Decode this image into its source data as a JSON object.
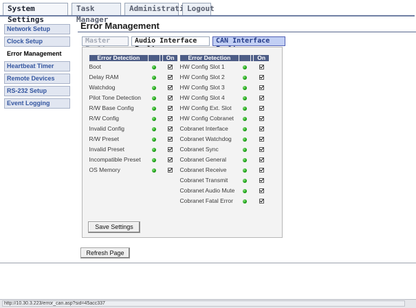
{
  "top_tabs": [
    {
      "label": "System Settings",
      "active": true
    },
    {
      "label": "Task Manager",
      "active": false
    },
    {
      "label": "Administration",
      "active": false
    },
    {
      "label": "Logout",
      "active": false
    }
  ],
  "sidebar": {
    "items": [
      {
        "label": "Network Setup",
        "active": false
      },
      {
        "label": "Clock Setup",
        "active": false
      },
      {
        "label": "Error Management",
        "active": true
      },
      {
        "label": "Heartbeat Timer",
        "active": false
      },
      {
        "label": "Remote Devices",
        "active": false
      },
      {
        "label": "RS-232 Setup",
        "active": false
      },
      {
        "label": "Event Logging",
        "active": false
      }
    ]
  },
  "page": {
    "title": "Error Management"
  },
  "sub_tabs": [
    {
      "label": "Master Fault",
      "state": "muted"
    },
    {
      "label": "Audio Interface Faults",
      "state": "plain"
    },
    {
      "label": "CAN Interface Faults",
      "state": "active"
    }
  ],
  "fault_tables": {
    "left": {
      "headers": {
        "detection": "Error Detection",
        "status": "",
        "on": "On"
      },
      "rows": [
        {
          "name": "Boot",
          "status": "ok",
          "on": true
        },
        {
          "name": "Delay RAM",
          "status": "ok",
          "on": true
        },
        {
          "name": "Watchdog",
          "status": "ok",
          "on": true
        },
        {
          "name": "Pilot Tone Detection",
          "status": "ok",
          "on": true
        },
        {
          "name": "R/W Base Config",
          "status": "ok",
          "on": true
        },
        {
          "name": "R/W Config",
          "status": "ok",
          "on": true
        },
        {
          "name": "Invalid Config",
          "status": "ok",
          "on": true
        },
        {
          "name": "R/W Preset",
          "status": "ok",
          "on": true
        },
        {
          "name": "Invalid Preset",
          "status": "ok",
          "on": true
        },
        {
          "name": "Incompatible Preset",
          "status": "ok",
          "on": true
        },
        {
          "name": "OS Memory",
          "status": "ok",
          "on": true
        }
      ]
    },
    "right": {
      "headers": {
        "detection": "Error Detection",
        "status": "",
        "on": "On"
      },
      "rows": [
        {
          "name": "HW Config Slot 1",
          "status": "ok",
          "on": true
        },
        {
          "name": "HW Config Slot 2",
          "status": "ok",
          "on": true
        },
        {
          "name": "HW Config Slot 3",
          "status": "ok",
          "on": true
        },
        {
          "name": "HW Config Slot 4",
          "status": "ok",
          "on": true
        },
        {
          "name": "HW Config Ext. Slot",
          "status": "ok",
          "on": true
        },
        {
          "name": "HW Config Cobranet",
          "status": "ok",
          "on": true
        },
        {
          "name": "Cobranet Interface",
          "status": "ok",
          "on": true
        },
        {
          "name": "Cobranet Watchdog",
          "status": "ok",
          "on": true
        },
        {
          "name": "Cobranet Sync",
          "status": "ok",
          "on": true
        },
        {
          "name": "Cobranet General",
          "status": "ok",
          "on": true
        },
        {
          "name": "Cobranet Receive",
          "status": "ok",
          "on": true
        },
        {
          "name": "Cobranet Transmit",
          "status": "ok",
          "on": true
        },
        {
          "name": "Cobranet Audio Mute",
          "status": "ok",
          "on": true
        },
        {
          "name": "Cobranet Fatal Error",
          "status": "ok",
          "on": true
        }
      ]
    }
  },
  "buttons": {
    "save": "Save Settings",
    "refresh": "Refresh Page"
  },
  "status_bar": {
    "url": "http://10.30.3.223/error_can.asp?sid=45acc337"
  },
  "colors": {
    "header_bg": "#4d5d86",
    "active_tab_bg": "#c2cff4",
    "led_ok": "#1da617",
    "sidebar_link": "#3456a0"
  }
}
